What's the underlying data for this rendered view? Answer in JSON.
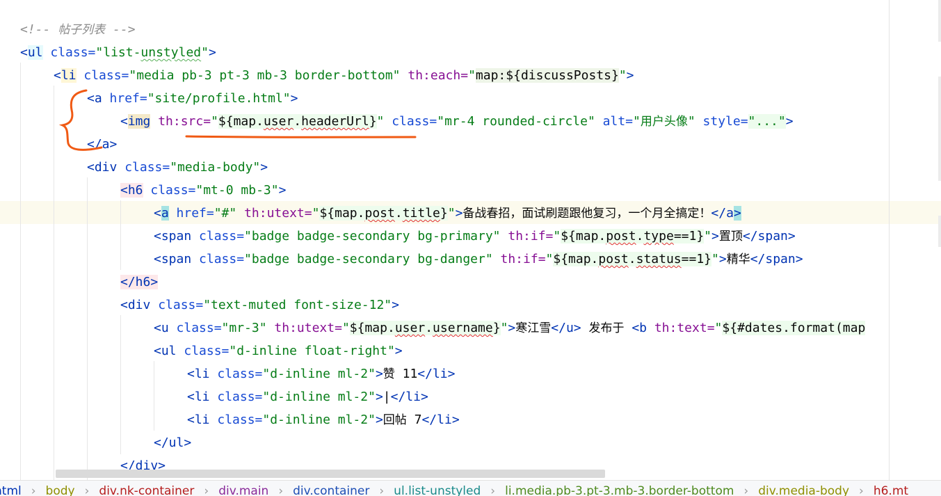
{
  "code_lines": [
    [
      {
        "t": "<!-- ",
        "c": "cmt"
      },
      {
        "t": "帖子列表",
        "c": "cmt cjk"
      },
      {
        "t": " -->",
        "c": "cmt"
      }
    ],
    [
      {
        "t": "<",
        "c": "tag"
      },
      {
        "t": "ul",
        "c": "tag"
      },
      {
        "t": " class=",
        "c": "attr"
      },
      {
        "t": "\"list-",
        "c": "val"
      },
      {
        "t": "unstyled",
        "c": "val sqg"
      },
      {
        "t": "\"",
        "c": "val"
      },
      {
        "t": ">",
        "c": "tag"
      }
    ],
    [
      {
        "t": "<",
        "c": "tag"
      },
      {
        "t": "li",
        "c": "tag"
      },
      {
        "t": " class=",
        "c": "attr"
      },
      {
        "t": "\"media pb-3 pt-3 mb-3 border-bottom\"",
        "c": "val"
      },
      {
        "t": " th:each=",
        "c": "th"
      },
      {
        "t": "\"",
        "c": "val"
      },
      {
        "t": "map:${discussPosts}",
        "c": "expr"
      },
      {
        "t": "\"",
        "c": "val"
      },
      {
        "t": ">",
        "c": "tag"
      }
    ],
    [
      {
        "t": "<a",
        "c": "tag"
      },
      {
        "t": " href=",
        "c": "attr"
      },
      {
        "t": "\"site/profile.html\"",
        "c": "val"
      },
      {
        "t": ">",
        "c": "tag"
      }
    ],
    [
      {
        "t": "<",
        "c": "tag"
      },
      {
        "t": "img",
        "c": "tag"
      },
      {
        "t": " th:src=",
        "c": "th"
      },
      {
        "t": "\"",
        "c": "val"
      },
      {
        "t": "${map.",
        "c": "expr"
      },
      {
        "t": "user",
        "c": "expr sq"
      },
      {
        "t": ".",
        "c": "expr"
      },
      {
        "t": "headerUrl",
        "c": "expr sq"
      },
      {
        "t": "}",
        "c": "expr"
      },
      {
        "t": "\"",
        "c": "val"
      },
      {
        "t": " class=",
        "c": "attr"
      },
      {
        "t": "\"mr-4 rounded-circle\"",
        "c": "val"
      },
      {
        "t": " alt=",
        "c": "attr"
      },
      {
        "t": "\"",
        "c": "val"
      },
      {
        "t": "用户头像",
        "c": "val cjk"
      },
      {
        "t": "\"",
        "c": "val"
      },
      {
        "t": " style=",
        "c": "attr"
      },
      {
        "t": "\"...\"",
        "c": "val"
      },
      {
        "t": ">",
        "c": "tag"
      }
    ],
    [
      {
        "t": "</a>",
        "c": "tag"
      }
    ],
    [
      {
        "t": "<div",
        "c": "tag"
      },
      {
        "t": " class=",
        "c": "attr"
      },
      {
        "t": "\"media-body\"",
        "c": "val"
      },
      {
        "t": ">",
        "c": "tag"
      }
    ],
    [
      {
        "t": "<h6",
        "c": "tag"
      },
      {
        "t": " class=",
        "c": "attr"
      },
      {
        "t": "\"mt-0 mb-3\"",
        "c": "val"
      },
      {
        "t": ">",
        "c": "tag"
      }
    ],
    [
      {
        "t": "<",
        "c": "tag"
      },
      {
        "t": "a",
        "c": "tag"
      },
      {
        "t": " href=",
        "c": "attr"
      },
      {
        "t": "\"#\"",
        "c": "val"
      },
      {
        "t": " th:utext=",
        "c": "th"
      },
      {
        "t": "\"",
        "c": "val"
      },
      {
        "t": "${map.",
        "c": "expr"
      },
      {
        "t": "post",
        "c": "expr sq"
      },
      {
        "t": ".",
        "c": "expr"
      },
      {
        "t": "title",
        "c": "expr sq"
      },
      {
        "t": "}",
        "c": "expr"
      },
      {
        "t": "\"",
        "c": "val"
      },
      {
        "t": ">",
        "c": "tag"
      },
      {
        "t": "备战春招，面试刷题跟他复习，一个月全搞定！",
        "c": "cjk"
      },
      {
        "t": "</",
        "c": "tag"
      },
      {
        "t": "a",
        "c": "tag"
      },
      {
        "t": ">",
        "c": "tag"
      }
    ],
    [
      {
        "t": "<span",
        "c": "tag"
      },
      {
        "t": " class=",
        "c": "attr"
      },
      {
        "t": "\"badge badge-secondary bg-primary\"",
        "c": "val"
      },
      {
        "t": " th:if=",
        "c": "th"
      },
      {
        "t": "\"",
        "c": "val"
      },
      {
        "t": "${map.",
        "c": "expr"
      },
      {
        "t": "post",
        "c": "expr sq"
      },
      {
        "t": ".",
        "c": "expr"
      },
      {
        "t": "type",
        "c": "expr sq"
      },
      {
        "t": "==1}",
        "c": "expr"
      },
      {
        "t": "\"",
        "c": "val"
      },
      {
        "t": ">",
        "c": "tag"
      },
      {
        "t": "置顶",
        "c": "cjk"
      },
      {
        "t": "</span>",
        "c": "tag"
      }
    ],
    [
      {
        "t": "<span",
        "c": "tag"
      },
      {
        "t": " class=",
        "c": "attr"
      },
      {
        "t": "\"badge badge-secondary bg-danger\"",
        "c": "val"
      },
      {
        "t": " th:if=",
        "c": "th"
      },
      {
        "t": "\"",
        "c": "val"
      },
      {
        "t": "${map.",
        "c": "expr"
      },
      {
        "t": "post",
        "c": "expr sq"
      },
      {
        "t": ".",
        "c": "expr"
      },
      {
        "t": "status",
        "c": "expr sq"
      },
      {
        "t": "==1}",
        "c": "expr"
      },
      {
        "t": "\"",
        "c": "val"
      },
      {
        "t": ">",
        "c": "tag"
      },
      {
        "t": "精华",
        "c": "cjk"
      },
      {
        "t": "</span>",
        "c": "tag"
      }
    ],
    [
      {
        "t": "</h6>",
        "c": "tag"
      }
    ],
    [
      {
        "t": "<div",
        "c": "tag"
      },
      {
        "t": " class=",
        "c": "attr"
      },
      {
        "t": "\"text-muted font-size-12\"",
        "c": "val"
      },
      {
        "t": ">",
        "c": "tag"
      }
    ],
    [
      {
        "t": "<u",
        "c": "tag"
      },
      {
        "t": " class=",
        "c": "attr"
      },
      {
        "t": "\"mr-3\"",
        "c": "val"
      },
      {
        "t": " th:utext=",
        "c": "th"
      },
      {
        "t": "\"",
        "c": "val"
      },
      {
        "t": "${map.",
        "c": "expr"
      },
      {
        "t": "user",
        "c": "expr sq"
      },
      {
        "t": ".",
        "c": "expr"
      },
      {
        "t": "username",
        "c": "expr sq"
      },
      {
        "t": "}",
        "c": "expr"
      },
      {
        "t": "\"",
        "c": "val"
      },
      {
        "t": ">",
        "c": "tag"
      },
      {
        "t": "寒江雪",
        "c": "cjk"
      },
      {
        "t": "</u>",
        "c": "tag"
      },
      {
        "t": " ",
        "c": ""
      },
      {
        "t": "发布于",
        "c": "cjk"
      },
      {
        "t": " ",
        "c": ""
      },
      {
        "t": "<b",
        "c": "tag"
      },
      {
        "t": " th:text=",
        "c": "th"
      },
      {
        "t": "\"",
        "c": "val"
      },
      {
        "t": "${#dates.format(map",
        "c": "expr"
      }
    ],
    [
      {
        "t": "<ul",
        "c": "tag"
      },
      {
        "t": " class=",
        "c": "attr"
      },
      {
        "t": "\"d-inline float-right\"",
        "c": "val"
      },
      {
        "t": ">",
        "c": "tag"
      }
    ],
    [
      {
        "t": "<li",
        "c": "tag"
      },
      {
        "t": " class=",
        "c": "attr"
      },
      {
        "t": "\"d-inline ml-2\"",
        "c": "val"
      },
      {
        "t": ">",
        "c": "tag"
      },
      {
        "t": "赞",
        "c": "cjk"
      },
      {
        "t": " 11",
        "c": ""
      },
      {
        "t": "</li>",
        "c": "tag"
      }
    ],
    [
      {
        "t": "<li",
        "c": "tag"
      },
      {
        "t": " class=",
        "c": "attr"
      },
      {
        "t": "\"d-inline ml-2\"",
        "c": "val"
      },
      {
        "t": ">",
        "c": "tag"
      },
      {
        "t": "|",
        "c": ""
      },
      {
        "t": "</li>",
        "c": "tag"
      }
    ],
    [
      {
        "t": "<li",
        "c": "tag"
      },
      {
        "t": " class=",
        "c": "attr"
      },
      {
        "t": "\"d-inline ml-2\"",
        "c": "val"
      },
      {
        "t": ">",
        "c": "tag"
      },
      {
        "t": "回帖",
        "c": "cjk"
      },
      {
        "t": " 7",
        "c": ""
      },
      {
        "t": "</li>",
        "c": "tag"
      }
    ],
    [
      {
        "t": "</ul>",
        "c": "tag"
      }
    ],
    [
      {
        "t": "</div>",
        "c": "tag"
      }
    ]
  ],
  "breadcrumbs": [
    {
      "label": "html",
      "color": "#0033b3"
    },
    {
      "label": "body",
      "color": "#8f8f00"
    },
    {
      "label": "div.nk-container",
      "color": "#b51e1e"
    },
    {
      "label": "div.main",
      "color": "#8a2b9a"
    },
    {
      "label": "div.container",
      "color": "#1f4fb5"
    },
    {
      "label": "ul.list-unstyled",
      "color": "#1a8a8a"
    },
    {
      "label": "li.media.pb-3.pt-3.mb-3.border-bottom",
      "color": "#4e8a1e"
    },
    {
      "label": "div.media-body",
      "color": "#8f8f00"
    },
    {
      "label": "h6.mt",
      "color": "#b51e1e"
    }
  ],
  "annotation": {
    "color": "#f05a14"
  }
}
